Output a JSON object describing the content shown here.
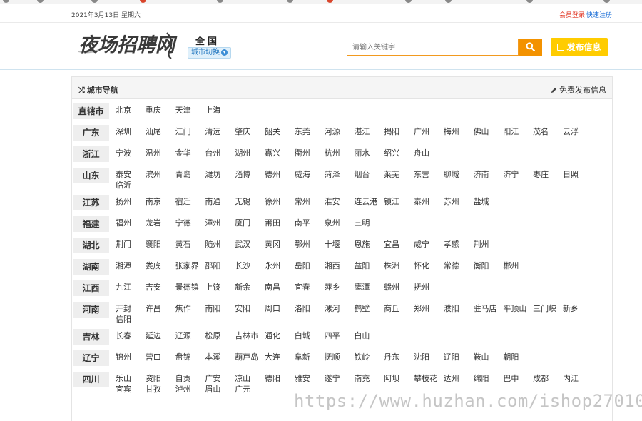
{
  "top_bar": {
    "date": "2021年3月13日 星期六",
    "login": "会员登录",
    "register": "快速注册"
  },
  "header": {
    "logo_text": "夜场招聘网",
    "location": "全国",
    "city_switch": "城市切换",
    "search_placeholder": "请输入关键字",
    "publish_label": "发布信息"
  },
  "panel": {
    "title": "城市导航",
    "free_publish": "免费发布信息"
  },
  "provinces": [
    {
      "name": "直辖市",
      "cities": [
        "北京",
        "重庆",
        "天津",
        "上海"
      ]
    },
    {
      "name": "广东",
      "cities": [
        "深圳",
        "汕尾",
        "江门",
        "清远",
        "肇庆",
        "韶关",
        "东莞",
        "河源",
        "湛江",
        "揭阳",
        "广州",
        "梅州",
        "佛山",
        "阳江",
        "茂名",
        "云浮"
      ]
    },
    {
      "name": "浙江",
      "cities": [
        "宁波",
        "温州",
        "金华",
        "台州",
        "湖州",
        "嘉兴",
        "衢州",
        "杭州",
        "丽水",
        "绍兴",
        "舟山"
      ]
    },
    {
      "name": "山东",
      "cities": [
        "泰安",
        "滨州",
        "青岛",
        "潍坊",
        "淄博",
        "德州",
        "威海",
        "菏泽",
        "烟台",
        "莱芜",
        "东营",
        "聊城",
        "济南",
        "济宁",
        "枣庄",
        "日照",
        "临沂"
      ]
    },
    {
      "name": "江苏",
      "cities": [
        "扬州",
        "南京",
        "宿迁",
        "南通",
        "无锡",
        "徐州",
        "常州",
        "淮安",
        "连云港",
        "镇江",
        "泰州",
        "苏州",
        "盐城"
      ]
    },
    {
      "name": "福建",
      "cities": [
        "福州",
        "龙岩",
        "宁德",
        "漳州",
        "厦门",
        "莆田",
        "南平",
        "泉州",
        "三明"
      ]
    },
    {
      "name": "湖北",
      "cities": [
        "荆门",
        "襄阳",
        "黄石",
        "随州",
        "武汉",
        "黄冈",
        "鄂州",
        "十堰",
        "恩施",
        "宜昌",
        "咸宁",
        "孝感",
        "荆州"
      ]
    },
    {
      "name": "湖南",
      "cities": [
        "湘潭",
        "娄底",
        "张家界",
        "邵阳",
        "长沙",
        "永州",
        "岳阳",
        "湘西",
        "益阳",
        "株洲",
        "怀化",
        "常德",
        "衡阳",
        "郴州"
      ]
    },
    {
      "name": "江西",
      "cities": [
        "九江",
        "吉安",
        "景德镇",
        "上饶",
        "新余",
        "南昌",
        "宜春",
        "萍乡",
        "鹰潭",
        "赣州",
        "抚州"
      ]
    },
    {
      "name": "河南",
      "cities": [
        "开封",
        "许昌",
        "焦作",
        "南阳",
        "安阳",
        "周口",
        "洛阳",
        "漯河",
        "鹤壁",
        "商丘",
        "郑州",
        "濮阳",
        "驻马店",
        "平顶山",
        "三门峡",
        "新乡",
        "信阳"
      ]
    },
    {
      "name": "吉林",
      "cities": [
        "长春",
        "延边",
        "辽源",
        "松原",
        "吉林市",
        "通化",
        "白城",
        "四平",
        "白山"
      ]
    },
    {
      "name": "辽宁",
      "cities": [
        "锦州",
        "营口",
        "盘锦",
        "本溪",
        "葫芦岛",
        "大连",
        "阜新",
        "抚顺",
        "铁岭",
        "丹东",
        "沈阳",
        "辽阳",
        "鞍山",
        "朝阳"
      ]
    },
    {
      "name": "四川",
      "cities": [
        "乐山",
        "资阳",
        "自贡",
        "广安",
        "凉山",
        "德阳",
        "雅安",
        "遂宁",
        "南充",
        "阿坝",
        "攀枝花",
        "达州",
        "绵阳",
        "巴中",
        "成都",
        "内江",
        "宜宾",
        "甘孜",
        "泸州",
        "眉山",
        "广元"
      ]
    }
  ],
  "watermark": "https://www.huzhan.com/ishop27010",
  "colors": {
    "accent_orange": "#f39200",
    "publish_yellow": "#ffcc00",
    "login_red": "#e0301e",
    "link_blue": "#1a6dd6"
  }
}
